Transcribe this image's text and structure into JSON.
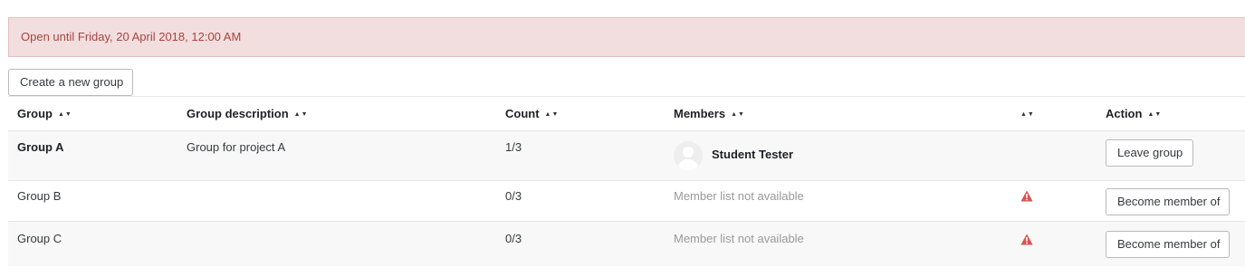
{
  "alert": {
    "text": "Open until Friday, 20 April 2018, 12:00 AM"
  },
  "toolbar": {
    "create_label": "Create a new group"
  },
  "table": {
    "columns": {
      "group": "Group",
      "description": "Group description",
      "count": "Count",
      "members": "Members",
      "status": "",
      "action": "Action"
    },
    "sort_icon": "▲▼",
    "rows": [
      {
        "group": "Group A",
        "description": "Group for project A",
        "count": "1/3",
        "member_name": "Student Tester",
        "action_label": "Leave group"
      },
      {
        "group": "Group B",
        "description": "",
        "count": "0/3",
        "members_text": "Member list not available",
        "action_label": "Become member of"
      },
      {
        "group": "Group C",
        "description": "",
        "count": "0/3",
        "members_text": "Member list not available",
        "action_label": "Become member of"
      }
    ]
  },
  "colors": {
    "alert_bg": "#f2dede",
    "alert_text": "#a94442",
    "warning_icon": "#d9534f"
  },
  "icons": {
    "sort": "sort-icon",
    "avatar": "user-avatar-placeholder",
    "warning": "warning-triangle-icon"
  }
}
